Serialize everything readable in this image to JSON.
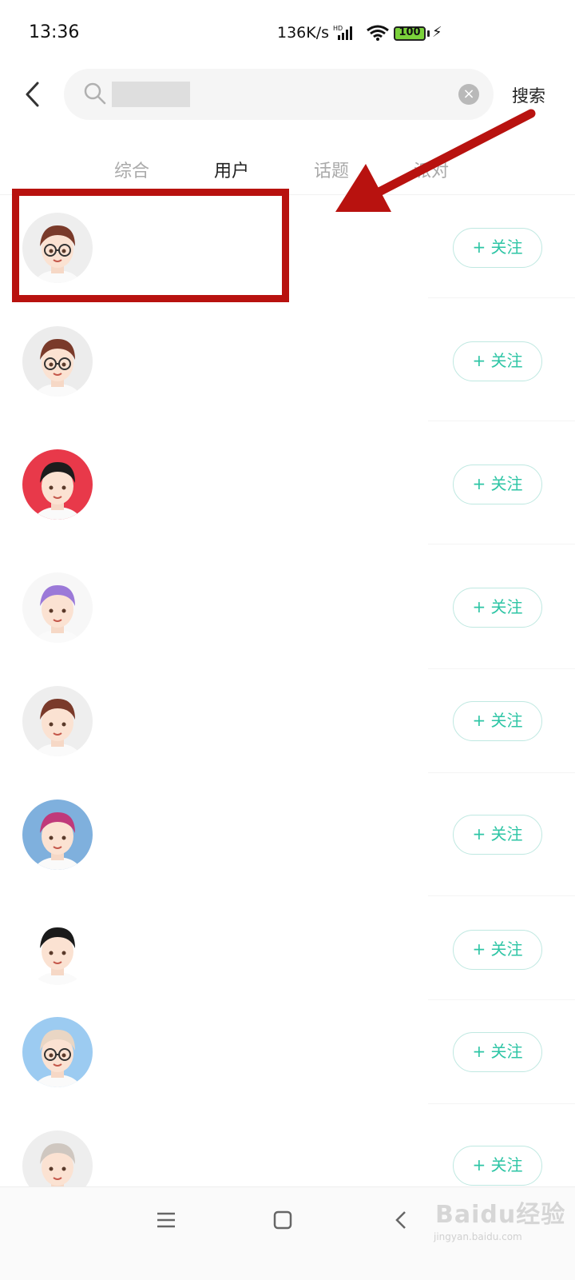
{
  "status_bar": {
    "time": "13:36",
    "network_speed": "136K/s",
    "signal_label": "HD",
    "battery": "100"
  },
  "search": {
    "query_hidden": true,
    "clear_icon": "close-circle-icon",
    "submit_label": "搜索"
  },
  "tabs": [
    {
      "label": "综合",
      "active": false
    },
    {
      "label": "用户",
      "active": true
    },
    {
      "label": "话题",
      "active": false
    },
    {
      "label": "派对",
      "active": false
    }
  ],
  "users": [
    {
      "follow_label": "+ 关注",
      "avatar_bg": "#eeeeee",
      "hair": "#7a3a2a",
      "glasses": true,
      "highlighted": true
    },
    {
      "follow_label": "+ 关注",
      "avatar_bg": "#ececec",
      "hair": "#7a3a2a",
      "glasses": true
    },
    {
      "follow_label": "+ 关注",
      "avatar_bg": "#e8394a",
      "hair": "#1c1c1c",
      "glasses": false
    },
    {
      "follow_label": "+ 关注",
      "avatar_bg": "#f7f7f7",
      "hair": "#9b79d8",
      "glasses": false
    },
    {
      "follow_label": "+ 关注",
      "avatar_bg": "#eeeeee",
      "hair": "#7a3a2a",
      "glasses": false
    },
    {
      "follow_label": "+ 关注",
      "avatar_bg": "#7fb0dd",
      "hair": "#c0397a",
      "glasses": false
    },
    {
      "follow_label": "+ 关注",
      "avatar_bg": "#ffffff",
      "hair": "#1a1a1a",
      "glasses": false
    },
    {
      "follow_label": "+ 关注",
      "avatar_bg": "#9ccbf1",
      "hair": "#e9d6c4",
      "glasses": true
    },
    {
      "follow_label": "+ 关注",
      "avatar_bg": "#eeeeee",
      "hair": "#cfc7c0",
      "glasses": false
    }
  ],
  "watermark": {
    "text": "Baidu经验",
    "sub": "jingyan.baidu.com"
  },
  "colors": {
    "accent": "#2ec5a5",
    "annotation": "#b8120f"
  }
}
